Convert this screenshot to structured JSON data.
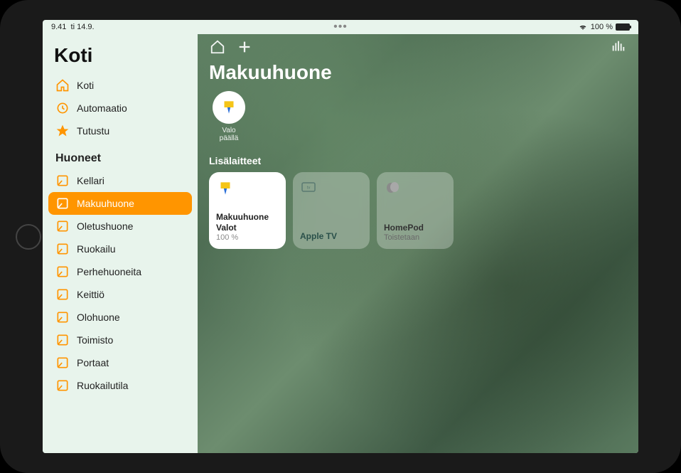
{
  "status": {
    "time": "9.41",
    "date": "ti 14.9.",
    "battery_pct": "100 %"
  },
  "sidebar": {
    "title": "Koti",
    "nav": [
      {
        "label": "Koti",
        "icon": "home"
      },
      {
        "label": "Automaatio",
        "icon": "clock"
      },
      {
        "label": "Tutustu",
        "icon": "star"
      }
    ],
    "rooms_header": "Huoneet",
    "rooms": [
      {
        "label": "Kellari"
      },
      {
        "label": "Makuuhuone",
        "selected": true
      },
      {
        "label": "Oletushuone"
      },
      {
        "label": "Ruokailu"
      },
      {
        "label": "Perhehuoneita"
      },
      {
        "label": "Keittiö"
      },
      {
        "label": "Olohuone"
      },
      {
        "label": "Toimisto"
      },
      {
        "label": "Portaat"
      },
      {
        "label": "Ruokailutila"
      }
    ]
  },
  "main": {
    "title": "Makuuhuone",
    "scene": {
      "label": "Valo\npäällä"
    },
    "accessories_header": "Lisälaitteet",
    "tiles": [
      {
        "name": "Makuuhuone Valot",
        "sub": "100 %",
        "type": "light"
      },
      {
        "name": "Apple TV",
        "sub": "",
        "type": "appletv"
      },
      {
        "name": "HomePod",
        "sub": "Toistetaan",
        "type": "homepod"
      }
    ]
  },
  "colors": {
    "accent": "#ff9500",
    "room_icon": "#ff9500",
    "star": "#ff9500"
  }
}
